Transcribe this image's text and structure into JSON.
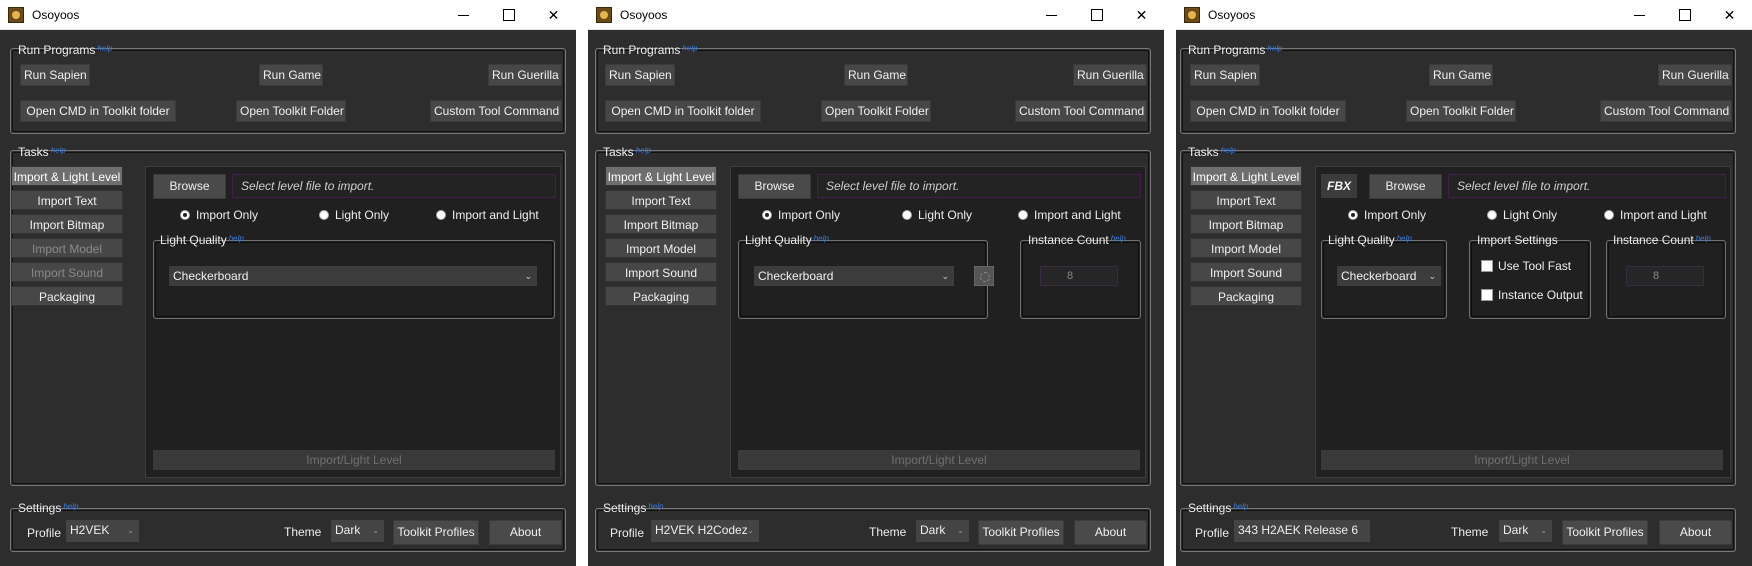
{
  "app_title": "Osoyoos",
  "window_controls": {
    "minimize": "",
    "maximize": "",
    "close": "✕"
  },
  "run_programs": {
    "label": "Run Programs",
    "help": "help",
    "run_sapien": "Run Sapien",
    "run_game": "Run Game",
    "run_guerilla": "Run Guerilla",
    "open_cmd": "Open CMD in Toolkit folder",
    "open_toolkit_folder": "Open Toolkit Folder",
    "custom_tool_command": "Custom Tool Command"
  },
  "tasks": {
    "label": "Tasks",
    "help": "help",
    "tabs": [
      "Import & Light Level",
      "Import Text",
      "Import Bitmap",
      "Import Model",
      "Import Sound",
      "Packaging"
    ]
  },
  "import_panel": {
    "browse": "Browse",
    "file_placeholder": "Select level file to import.",
    "radio_import_only": "Import Only",
    "radio_light_only": "Light Only",
    "radio_import_and_light": "Import and Light",
    "light_quality_label": "Light Quality",
    "light_quality_help": "help",
    "light_quality_value": "Checkerboard",
    "instance_count_label": "Instance Count",
    "instance_count_help": "help",
    "instance_count_value": "8",
    "import_settings_label": "Import Settings",
    "use_tool_fast": "Use Tool Fast",
    "instance_output": "Instance Output",
    "fbx": "FBX",
    "action": "Import/Light Level"
  },
  "settings": {
    "label": "Settings",
    "help": "help",
    "profile_label": "Profile",
    "profiles": [
      "H2VEK",
      "H2VEK H2Codez",
      "343 H2AEK Release 6"
    ],
    "theme_label": "Theme",
    "theme_value": "Dark",
    "toolkit_profiles": "Toolkit Profiles",
    "about": "About"
  },
  "icons": {
    "app": "osoyoos-app-icon",
    "dropdown": "chevron-down-icon",
    "spin": "refresh-icon"
  }
}
